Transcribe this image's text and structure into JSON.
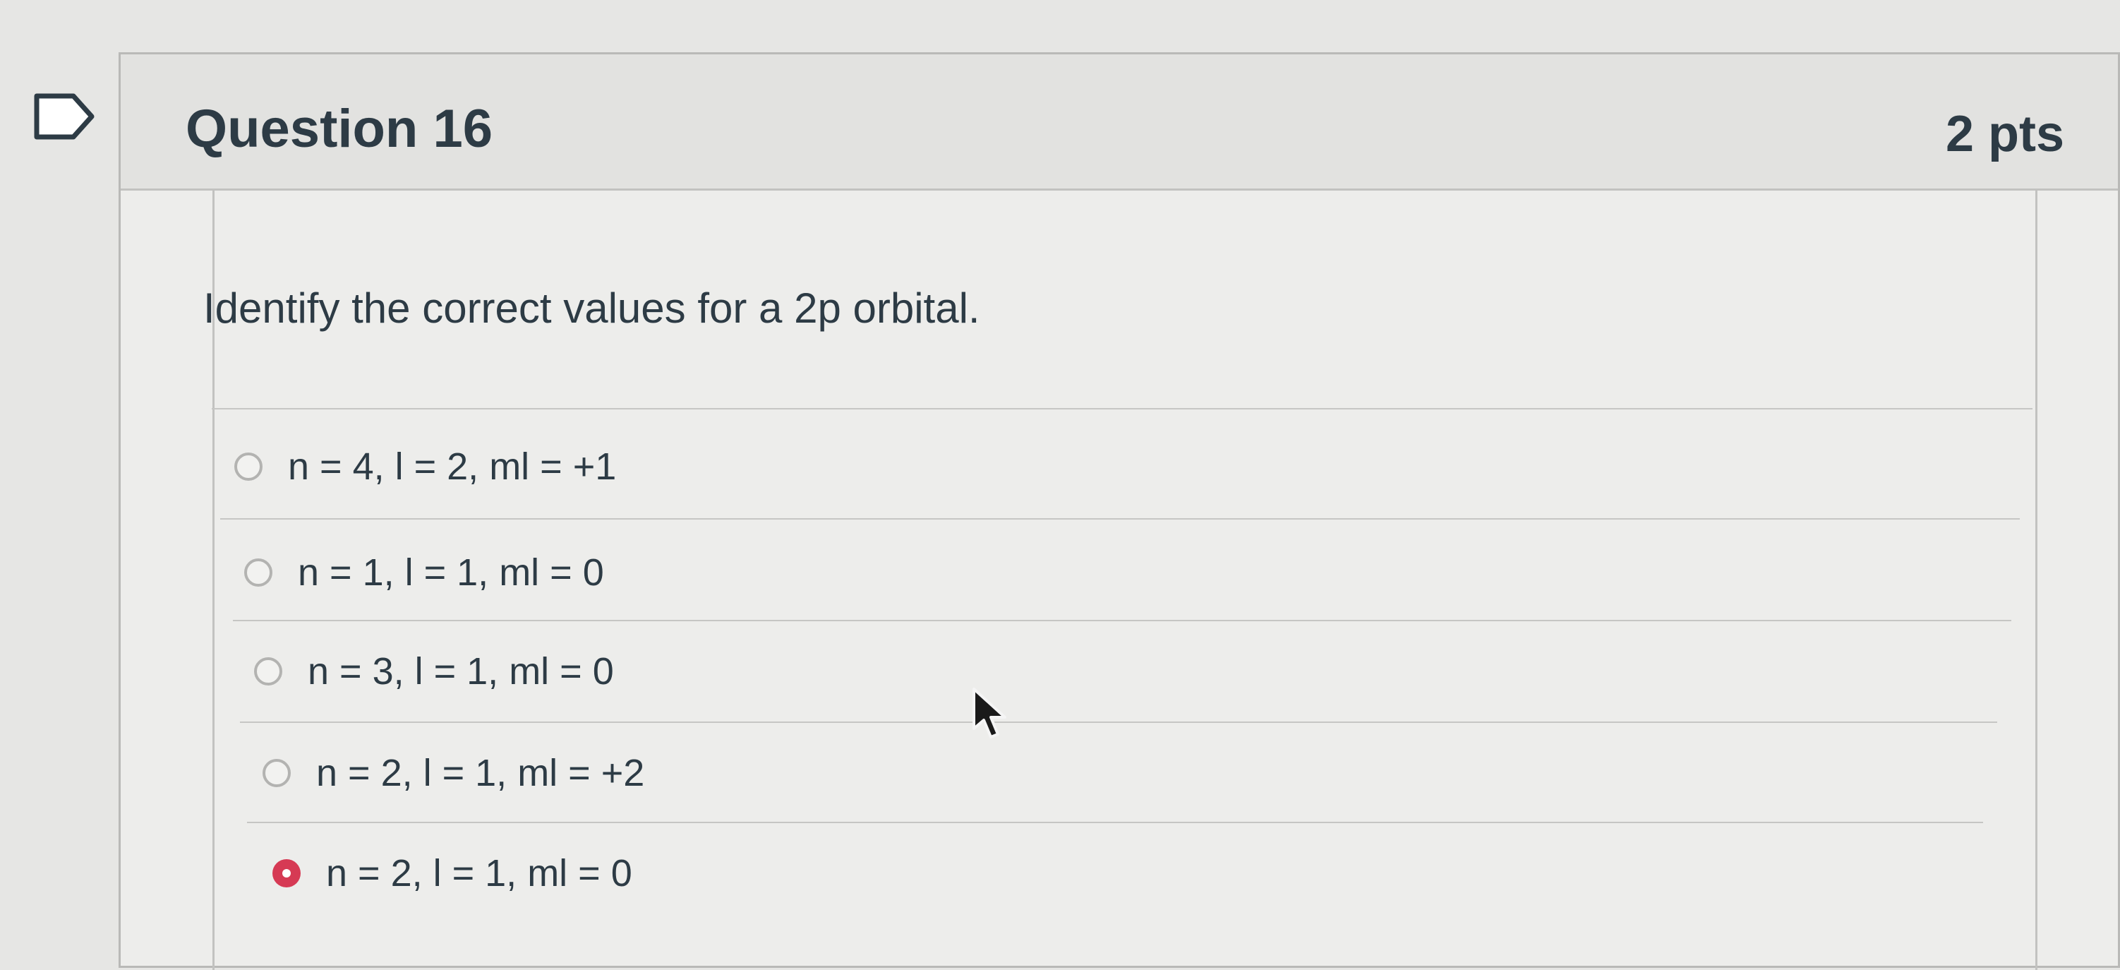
{
  "question": {
    "title": "Question 16",
    "points": "2 pts",
    "text": "Identify the correct values for a 2p orbital."
  },
  "answers": [
    {
      "label": "n = 4, l = 2, ml = +1",
      "selected": false
    },
    {
      "label": "n = 1, l = 1, ml = 0",
      "selected": false
    },
    {
      "label": "n = 3, l = 1, ml = 0",
      "selected": false
    },
    {
      "label": "n = 2, l = 1, ml = +2",
      "selected": false
    },
    {
      "label": "n = 2, l = 1, ml = 0",
      "selected": true
    }
  ],
  "colors": {
    "accent": "#d63a54",
    "text": "#2d3b45"
  }
}
